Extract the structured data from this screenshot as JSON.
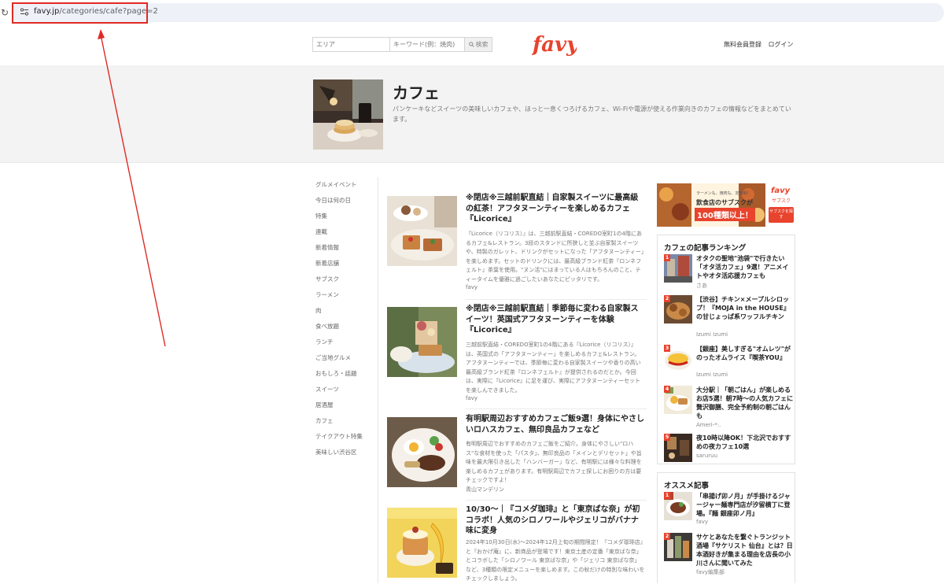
{
  "browser": {
    "url_host": "favy.jp",
    "url_path": "/categories/cafe?page=2"
  },
  "header": {
    "search_area_placeholder": "エリア",
    "search_keyword_placeholder": "キーワード(例：焼肉)",
    "search_button": "検索",
    "logo_text": "favy",
    "links": [
      "無料会員登録",
      "ログイン"
    ]
  },
  "hero": {
    "title": "カフェ",
    "description": "パンケーキなどスイーツの美味しいカフェや、ほっと一息くつろげるカフェ、Wi-Fiや電源が使える作業向きのカフェの情報などをまとめています。"
  },
  "left_nav": [
    "グルメイベント",
    "今日は何の日",
    "特集",
    "連載",
    "新着情報",
    "新着店舗",
    "サブスク",
    "ラーメン",
    "肉",
    "食べ放題",
    "ランチ",
    "ご当地グルメ",
    "おもしろ・話題",
    "スイーツ",
    "居酒屋",
    "カフェ",
    "テイクアウト特集",
    "美味しい渋谷区"
  ],
  "articles": [
    {
      "title": "※閉店※三越前駅直結｜自家製スイーツに最高級の紅茶！アフタヌーンティーを楽しめるカフェ『Licorice』",
      "excerpt": "『Licorice（リコリス）』は、三越前駅直結・COREDO室町1の4階にあるカフェ&レストラン。3段のスタンドに所狭しと並ぶ自家製スイーツや、特製のガレット、ドリンクがセットになった「アフタヌーンティー」を楽しめます。セットのドリンクには、最高級ブランド紅茶『ロンネフェルト』茶葉を使用。\"ヌン活\"にはまっている人はもちろんのこと、ティータイムを優雅に過ごしたいあなたにピッタリです。",
      "author": "favy"
    },
    {
      "title": "※閉店※三越前駅直結｜季節毎に変わる自家製スイーツ！英国式アフタヌーンティーを体験『Licorice』",
      "excerpt": "三越前駅直結・COREDO室町1の4階にある『Licorice（リコリス）』は、英国式の「アフタヌーンティー」を楽しめるカフェ&レストラン。アフタヌーンティーでは、季節毎に変わる自家製スイーツや香りの高い最高級ブランド紅茶『ロンネフェルト』が提供されるのだとか。今回は、実際に『Licorice』に足を運び、実際にアフタヌーンティーセットを楽しんできました。",
      "author": "favy"
    },
    {
      "title": "有明駅周辺おすすめカフェご飯9選！身体にやさしいロハスカフェ、無印良品カフェなど",
      "excerpt": "有明駅周辺でおすすめのカフェご飯をご紹介。身体にやさしい\"ロハス\"な食材を使った「パスタ」、無印良品の「メインとデリセット」や旨味を最大限引き出した「ハンバーガー」など、有明駅には様々な料理を楽しめるカフェがあります。有明駅周辺でカフェ探しにお困りの方は要チェックですよ！",
      "author": "青山マンデリン"
    },
    {
      "title": "10/30〜｜『コメダ珈琲』と「東京ばな奈」が初コラボ！人気のシロノワールやジェリコがバナナ味に変身",
      "excerpt": "2024年10月30日(水)〜2024年12月上旬の期間限定！『コメダ珈琲店』と『おかげ庵』に、新商品が登場です！東京土産の定番「東京ばな奈」とコラボした「シロノワール 東京ばな奈」や「ジェリコ 東京ばな奈」など、3種類の限定メニューを楽しめます。この秋だけの特別な味わいをチェックしましょう。",
      "author": ""
    }
  ],
  "ad": {
    "small_text": "ラーメンも、焼肉も、定額制！",
    "line1": "飲食店のサブスクが",
    "highlight": "100種類以上！",
    "brand": "favy",
    "brand_sub": "サブスク",
    "cta": "サブスクを探す"
  },
  "ranking": {
    "title": "カフェの記事ランキング",
    "items": [
      {
        "rank": "1",
        "title": "オタクの聖地\"池袋\"で行きたい「オタ活カフェ」9選！アニメイトやオタ活応援カフェも",
        "author": "さあ"
      },
      {
        "rank": "2",
        "title": "【渋谷】チキン×メープルシロップ！『MOJA in the HOUSE』の甘じょっぱ系ワッフルチキン",
        "author": "Izumi Izumi"
      },
      {
        "rank": "3",
        "title": "【銀座】美しすぎる\"オムレツ\"がのったオムライス『喫茶YOU』",
        "author": "Izumi Izumi"
      },
      {
        "rank": "4",
        "title": "大分駅｜「朝ごはん」が楽しめるお店5選！朝7時〜の人気カフェに贅沢御膳、完全予約制の朝ごはんも",
        "author": "Ameri-*:."
      },
      {
        "rank": "5",
        "title": "夜10時以降OK！下北沢でおすすめの夜カフェ10選",
        "author": "saruruu"
      }
    ]
  },
  "recommend": {
    "title": "オススメ記事",
    "items": [
      {
        "rank": "1",
        "title": "「串揚げ卯ノ月」が手掛けるジャージャー麺専門店が汐留横丁に登場。『麺 銀座卯ノ月』",
        "author": "favy"
      },
      {
        "rank": "2",
        "title": "サケとあなたを繋ぐトランジット酒場『サケリスト 仙台』とは？日本酒好きが集まる理由を店長の小川さんに聞いてみた",
        "author": "favy編集部"
      }
    ]
  },
  "colors": {
    "brand_red": "#e8432d",
    "highlight_red": "#e02a24"
  }
}
